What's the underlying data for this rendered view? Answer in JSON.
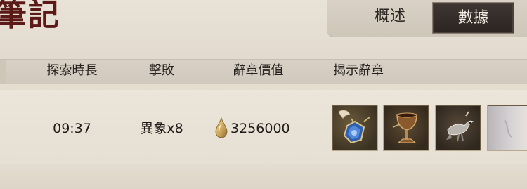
{
  "header": {
    "title": "筆記"
  },
  "tabs": {
    "overview_label": "概述",
    "data_label": "數據"
  },
  "table": {
    "columns": [
      "探索時長",
      "擊敗",
      "辭章價值",
      "揭示辭章"
    ],
    "row": {
      "time": "09:37",
      "defeated": "異象x8",
      "value": "3256000"
    }
  },
  "icons": {
    "currency": "amber-drop-icon",
    "items": [
      "feather-pendant-icon",
      "goblet-icon",
      "bird-figurine-icon",
      "partial-item-icon"
    ]
  },
  "colors": {
    "title": "#5b1a17",
    "active_tab_bg": "#2b2421",
    "currency_drop": "#c8a35a"
  }
}
